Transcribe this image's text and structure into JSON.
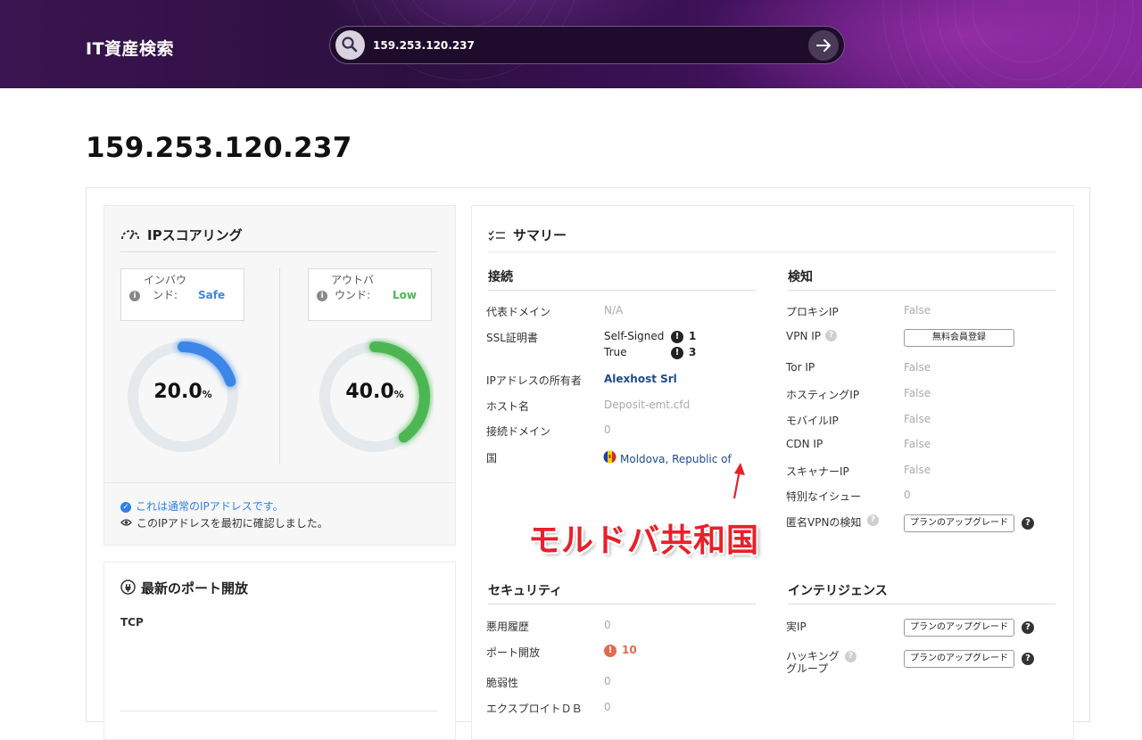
{
  "header": {
    "brand": "IT資産検索",
    "search_value": "159.253.120.237"
  },
  "page_title": "159.253.120.237",
  "scoring": {
    "title": "IPスコアリング",
    "inbound": {
      "label": "インバウンド:",
      "value": "Safe",
      "percent_text": "20.0",
      "percent_sign": "%",
      "level": 0.2,
      "color": "#3b86e6"
    },
    "outbound": {
      "label": "アウトバウンド:",
      "value": "Low",
      "percent_text": "40.0",
      "percent_sign": "%",
      "level": 0.4,
      "color": "#4cb653"
    },
    "note_normal": "これは通常のIPアドレスです。",
    "note_first": "このIPアドレスを最初に確認しました。"
  },
  "ports": {
    "title": "最新のポート開放",
    "tcp_label": "TCP"
  },
  "summary": {
    "title": "サマリー",
    "connection": {
      "title": "接続",
      "domain_label": "代表ドメイン",
      "domain_value": "N/A",
      "ssl_label": "SSL証明書",
      "ssl_self_label": "Self-Signed",
      "ssl_self_count": "1",
      "ssl_true_label": "True",
      "ssl_true_count": "3",
      "owner_label": "IPアドレスの所有者",
      "owner_value": "Alexhost Srl",
      "host_label": "ホスト名",
      "host_value": "Deposit-emt.cfd",
      "conn_domain_label": "接続ドメイン",
      "conn_domain_value": "0",
      "country_label": "国",
      "country_value": "Moldova, Republic of"
    },
    "detection": {
      "title": "検知",
      "proxy_label": "プロキシIP",
      "proxy_value": "False",
      "vpn_label": "VPN IP",
      "vpn_button": "無料会員登録",
      "tor_label": "Tor IP",
      "tor_value": "False",
      "hosting_label": "ホスティングIP",
      "hosting_value": "False",
      "mobile_label": "モバイルIP",
      "mobile_value": "False",
      "cdn_label": "CDN IP",
      "cdn_value": "False",
      "scanner_label": "スキャナーIP",
      "scanner_value": "False",
      "special_label": "特別なイシュー",
      "special_value": "0",
      "anon_vpn_label": "匿名VPNの検知",
      "anon_vpn_button": "プランのアップグレード"
    },
    "security": {
      "title": "セキュリティ",
      "abuse_label": "悪用履歴",
      "abuse_value": "0",
      "ports_label": "ポート開放",
      "ports_value": "10",
      "vuln_label": "脆弱性",
      "vuln_value": "0",
      "exploit_label": "エクスプロイトＤＢ",
      "exploit_value": "0"
    },
    "intelligence": {
      "title": "インテリジェンス",
      "real_ip_label": "実IP",
      "real_ip_button": "プランのアップグレード",
      "hacking_label_1": "ハッキング",
      "hacking_label_2": "グループ",
      "hacking_button": "プランのアップグレード"
    }
  },
  "annotation": "モルドバ共和国",
  "icons": {
    "question": "?",
    "info": "i",
    "check": "✓",
    "exclaim": "!"
  }
}
